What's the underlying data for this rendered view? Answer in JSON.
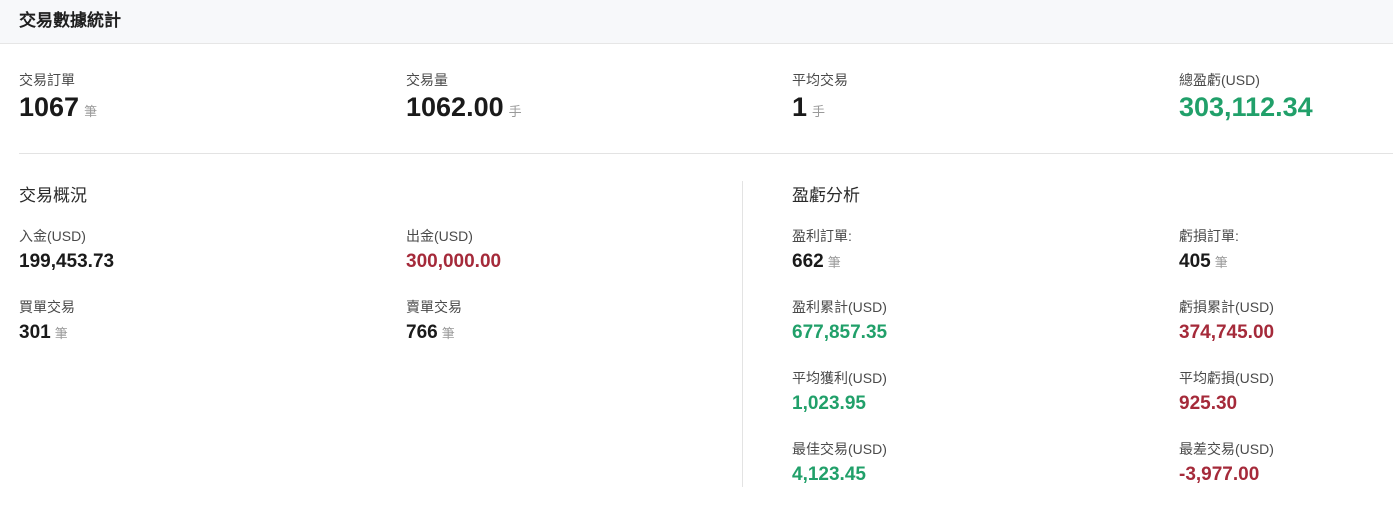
{
  "header": {
    "title": "交易數據統計"
  },
  "summary": {
    "orders": {
      "label": "交易訂單",
      "value": "1067",
      "unit": "筆"
    },
    "volume": {
      "label": "交易量",
      "value": "1062.00",
      "unit": "手"
    },
    "avg_trade": {
      "label": "平均交易",
      "value": "1",
      "unit": "手"
    },
    "total_pl": {
      "label": "總盈虧(USD)",
      "value": "303,112.34"
    }
  },
  "overview": {
    "title": "交易概況",
    "deposit": {
      "label": "入金(USD)",
      "value": "199,453.73"
    },
    "withdraw": {
      "label": "出金(USD)",
      "value": "300,000.00"
    },
    "buy_orders": {
      "label": "買單交易",
      "value": "301",
      "unit": "筆"
    },
    "sell_orders": {
      "label": "賣單交易",
      "value": "766",
      "unit": "筆"
    }
  },
  "pl_analysis": {
    "title": "盈虧分析",
    "profit_orders": {
      "label": "盈利訂單:",
      "value": "662",
      "unit": "筆"
    },
    "loss_orders": {
      "label": "虧損訂單:",
      "value": "405",
      "unit": "筆"
    },
    "profit_total": {
      "label": "盈利累計(USD)",
      "value": "677,857.35"
    },
    "loss_total": {
      "label": "虧損累計(USD)",
      "value": "374,745.00"
    },
    "avg_profit": {
      "label": "平均獲利(USD)",
      "value": "1,023.95"
    },
    "avg_loss": {
      "label": "平均虧損(USD)",
      "value": "925.30"
    },
    "best_trade": {
      "label": "最佳交易(USD)",
      "value": "4,123.45"
    },
    "worst_trade": {
      "label": "最差交易(USD)",
      "value": "-3,977.00"
    }
  },
  "colors": {
    "positive": "#21a06a",
    "negative": "#a52a3a"
  }
}
